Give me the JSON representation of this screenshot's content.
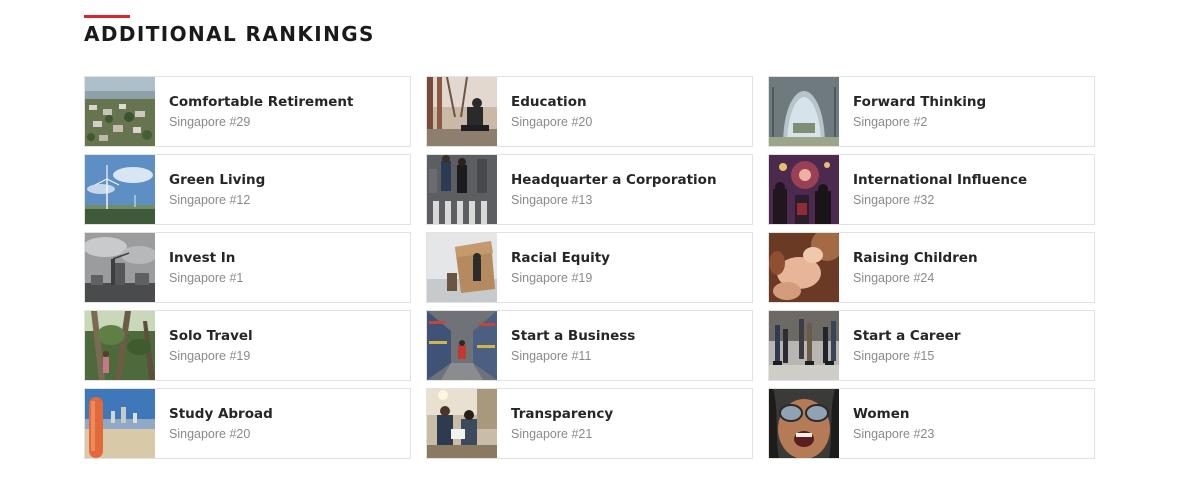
{
  "section": {
    "title": "ADDITIONAL RANKINGS",
    "accent_color": "#d9262e"
  },
  "rankings": [
    {
      "name": "Comfortable Retirement",
      "rank": "Singapore #29",
      "image": "aerial-town"
    },
    {
      "name": "Education",
      "rank": "Singapore #20",
      "image": "campus-statue"
    },
    {
      "name": "Forward Thinking",
      "rank": "Singapore #2",
      "image": "futuristic-building"
    },
    {
      "name": "Green Living",
      "rank": "Singapore #12",
      "image": "wind-turbine"
    },
    {
      "name": "Headquarter a Corporation",
      "rank": "Singapore #13",
      "image": "crosswalk-commuters"
    },
    {
      "name": "International Influence",
      "rank": "Singapore #32",
      "image": "fireworks-crowd"
    },
    {
      "name": "Invest In",
      "rank": "Singapore #1",
      "image": "industrial-skyline"
    },
    {
      "name": "Racial Equity",
      "rank": "Singapore #19",
      "image": "protest-sign"
    },
    {
      "name": "Raising Children",
      "rank": "Singapore #24",
      "image": "child-hands"
    },
    {
      "name": "Solo Travel",
      "rank": "Singapore #19",
      "image": "jungle-trees"
    },
    {
      "name": "Start a Business",
      "rank": "Singapore #11",
      "image": "warehouse-aisle"
    },
    {
      "name": "Start a Career",
      "rank": "Singapore #15",
      "image": "walking-legs"
    },
    {
      "name": "Study Abroad",
      "rank": "Singapore #20",
      "image": "beach-city"
    },
    {
      "name": "Transparency",
      "rank": "Singapore #21",
      "image": "office-meeting"
    },
    {
      "name": "Women",
      "rank": "Singapore #23",
      "image": "smiling-woman"
    }
  ]
}
